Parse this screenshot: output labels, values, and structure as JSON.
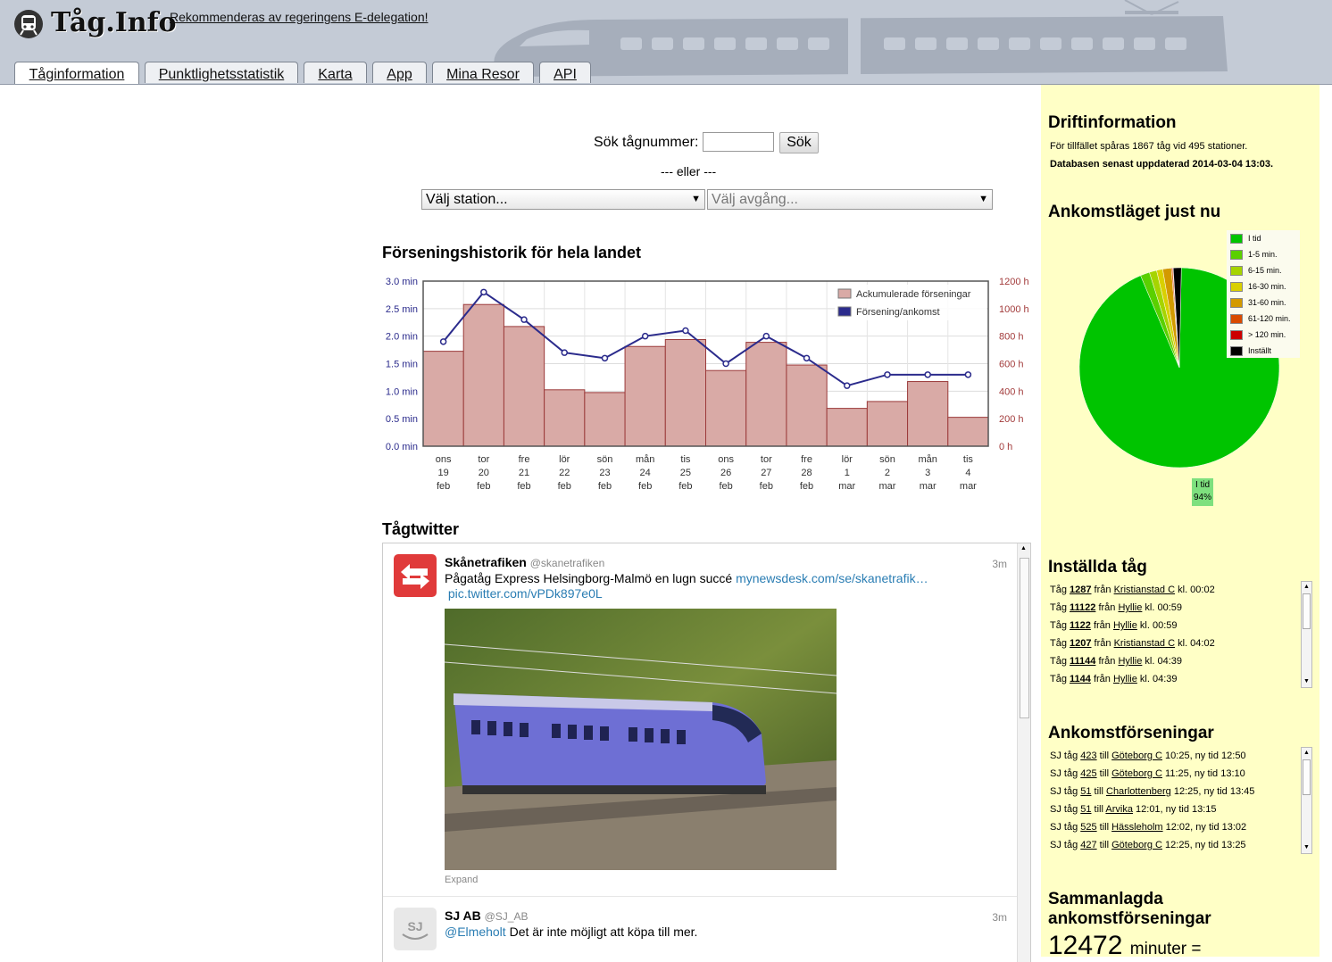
{
  "header": {
    "logo_text": "Tåg.Info",
    "slogan": "Rekommenderas av regeringens E-delegation!",
    "tabs": [
      {
        "label": "Tåginformation",
        "active": true
      },
      {
        "label": "Punktlighetsstatistik"
      },
      {
        "label": "Karta"
      },
      {
        "label": "App"
      },
      {
        "label": "Mina Resor"
      },
      {
        "label": "API"
      }
    ]
  },
  "search": {
    "label": "Sök tågnummer:",
    "input_value": "",
    "button_label": "Sök",
    "or_text": "--- eller ---",
    "station_select": "Välj station...",
    "departure_select": "Välj avgång..."
  },
  "chart_section": {
    "title": "Förseningshistorik för hela landet"
  },
  "chart_data": {
    "type": "bar",
    "title": "Förseningshistorik för hela landet",
    "categories": [
      [
        "ons",
        "19",
        "feb"
      ],
      [
        "tor",
        "20",
        "feb"
      ],
      [
        "fre",
        "21",
        "feb"
      ],
      [
        "lör",
        "22",
        "feb"
      ],
      [
        "sön",
        "23",
        "feb"
      ],
      [
        "mån",
        "24",
        "feb"
      ],
      [
        "tis",
        "25",
        "feb"
      ],
      [
        "ons",
        "26",
        "feb"
      ],
      [
        "tor",
        "27",
        "feb"
      ],
      [
        "fre",
        "28",
        "feb"
      ],
      [
        "lör",
        "1",
        "mar"
      ],
      [
        "sön",
        "2",
        "mar"
      ],
      [
        "mån",
        "3",
        "mar"
      ],
      [
        "tis",
        "4",
        "mar"
      ]
    ],
    "series": [
      {
        "name": "Ackumulerade förseningar",
        "type": "bar",
        "axis": "right",
        "unit": "h",
        "color": "#d9aaa6",
        "values": [
          690,
          1030,
          870,
          410,
          390,
          725,
          775,
          550,
          755,
          590,
          275,
          325,
          470,
          210
        ]
      },
      {
        "name": "Försening/ankomst",
        "type": "line",
        "axis": "left",
        "unit": "min",
        "color": "#2b2b8c",
        "values": [
          1.9,
          2.8,
          2.3,
          1.7,
          1.6,
          2.0,
          2.1,
          1.5,
          2.0,
          1.6,
          1.1,
          1.3,
          1.3,
          1.3
        ]
      }
    ],
    "left_axis": {
      "ticks": [
        "3.0 min",
        "2.5 min",
        "2.0 min",
        "1.5 min",
        "1.0 min",
        "0.5 min",
        "0.0 min"
      ],
      "range": [
        0,
        3.0
      ]
    },
    "right_axis": {
      "ticks": [
        "1200 h",
        "1000 h",
        "800 h",
        "600 h",
        "400 h",
        "200 h",
        "0 h"
      ],
      "range": [
        0,
        1200
      ]
    },
    "grid": true,
    "legend": "top-right"
  },
  "twitter": {
    "title": "Tågtwitter",
    "tweets": [
      {
        "name": "Skånetrafiken",
        "handle": "@skanetrafiken",
        "time": "3m",
        "text": "Pågatåg Express Helsingborg-Malmö en lugn succé ",
        "link1": "mynewsdesk.com/se/skanetrafik…",
        "link2": "pic.twitter.com/vPDk897e0L",
        "expand": "Expand"
      },
      {
        "name": "SJ AB",
        "handle": "@SJ_AB",
        "time": "3m",
        "mention": "@Elmeholt",
        "text": " Det är inte möjligt att köpa till mer."
      }
    ]
  },
  "sidebar": {
    "drift": {
      "title": "Driftinformation",
      "line1": "För tillfället spåras 1867 tåg vid 495 stationer.",
      "line2": "Databasen senast uppdaterad 2014-03-04 13:03."
    },
    "arrival": {
      "title": "Ankomstläget just nu",
      "legend": [
        {
          "label": "I tid",
          "color": "#00c400",
          "pct": 94
        },
        {
          "label": "1-5 min.",
          "color": "#5ad000",
          "pct": 1.5
        },
        {
          "label": "6-15 min.",
          "color": "#a6d400",
          "pct": 1.2
        },
        {
          "label": "16-30 min.",
          "color": "#d9d000",
          "pct": 1.0
        },
        {
          "label": "31-60 min.",
          "color": "#d39a00",
          "pct": 1.4
        },
        {
          "label": "61-120 min.",
          "color": "#d94b00",
          "pct": 0.2
        },
        {
          "label": "> 120 min.",
          "color": "#cc0000",
          "pct": 0.1
        },
        {
          "label": "Inställt",
          "color": "#000000",
          "pct": 1.3
        }
      ],
      "pie_label_name": "I tid",
      "pie_label_pct": "94%"
    },
    "cancelled": {
      "title": "Inställda tåg",
      "rows": [
        {
          "pre": "Tåg ",
          "num": "1287",
          "mid": " från ",
          "station": "Kristianstad C",
          "post": " kl. 00:02"
        },
        {
          "pre": "Tåg ",
          "num": "11122",
          "mid": " från ",
          "station": "Hyllie",
          "post": " kl. 00:59"
        },
        {
          "pre": "Tåg ",
          "num": "1122",
          "mid": " från ",
          "station": "Hyllie",
          "post": " kl. 00:59"
        },
        {
          "pre": "Tåg ",
          "num": "1207",
          "mid": " från ",
          "station": "Kristianstad C",
          "post": " kl. 04:02"
        },
        {
          "pre": "Tåg ",
          "num": "11144",
          "mid": " från ",
          "station": "Hyllie",
          "post": " kl. 04:39"
        },
        {
          "pre": "Tåg ",
          "num": "1144",
          "mid": " från ",
          "station": "Hyllie",
          "post": " kl. 04:39"
        }
      ]
    },
    "delays": {
      "title": "Ankomstförseningar",
      "rows": [
        {
          "pre": "SJ tåg ",
          "num": "423",
          "mid": " till ",
          "station": "Göteborg C",
          "post": " 10:25, ny tid 12:50"
        },
        {
          "pre": "SJ tåg ",
          "num": "425",
          "mid": " till ",
          "station": "Göteborg C",
          "post": " 11:25, ny tid 13:10"
        },
        {
          "pre": "SJ tåg ",
          "num": "51",
          "mid": " till ",
          "station": "Charlottenberg",
          "post": " 12:25, ny tid 13:45"
        },
        {
          "pre": "SJ tåg ",
          "num": "51",
          "mid": " till ",
          "station": "Arvika",
          "post": " 12:01, ny tid 13:15"
        },
        {
          "pre": "SJ tåg ",
          "num": "525",
          "mid": " till ",
          "station": "Hässleholm",
          "post": " 12:02, ny tid 13:02"
        },
        {
          "pre": "SJ tåg ",
          "num": "427",
          "mid": " till ",
          "station": "Göteborg C",
          "post": " 12:25, ny tid 13:25"
        }
      ]
    },
    "total": {
      "title": "Sammanlagda ankomstförseningar",
      "value": "12472",
      "unit": "minuter ="
    }
  }
}
